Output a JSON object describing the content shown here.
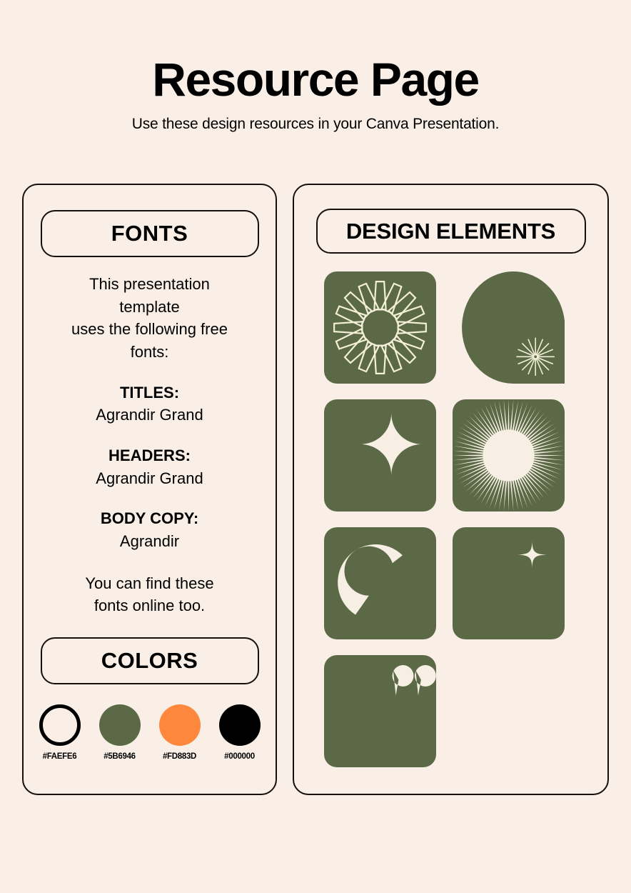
{
  "header": {
    "title": "Resource Page",
    "subtitle": "Use these design resources in your Canva Presentation."
  },
  "fonts_card": {
    "heading": "FONTS",
    "intro_line1": "This presentation",
    "intro_line2": "template",
    "intro_line3": "uses the following free",
    "intro_line4": "fonts:",
    "groups": [
      {
        "label": "TITLES:",
        "value": "Agrandir Grand"
      },
      {
        "label": "HEADERS:",
        "value": "Agrandir Grand"
      },
      {
        "label": "BODY COPY:",
        "value": "Agrandir"
      }
    ],
    "outro_line1": "You can find these",
    "outro_line2": "fonts online too."
  },
  "colors_card": {
    "heading": "COLORS",
    "swatches": [
      {
        "hex": "#FAEFE6",
        "label": "#FAEFE6",
        "style": "outline"
      },
      {
        "hex": "#5B6946",
        "label": "#5B6946",
        "style": "filled"
      },
      {
        "hex": "#FD883D",
        "label": "#FD883D",
        "style": "filled"
      },
      {
        "hex": "#000000",
        "label": "#000000",
        "style": "filled"
      }
    ]
  },
  "elements_card": {
    "heading": "DESIGN ELEMENTS",
    "tiles": [
      {
        "name": "radial-petal-burst"
      },
      {
        "name": "arch-shape-with-starburst"
      },
      {
        "name": "concave-four-point-star"
      },
      {
        "name": "fine-ray-sunburst"
      },
      {
        "name": "thick-arc-crescent"
      },
      {
        "name": "sparkle-star"
      },
      {
        "name": "quotation-marks"
      }
    ]
  },
  "theme": {
    "background": "#FAEFE6",
    "green": "#5B6946",
    "orange": "#FD883D",
    "ink": "#000000"
  }
}
